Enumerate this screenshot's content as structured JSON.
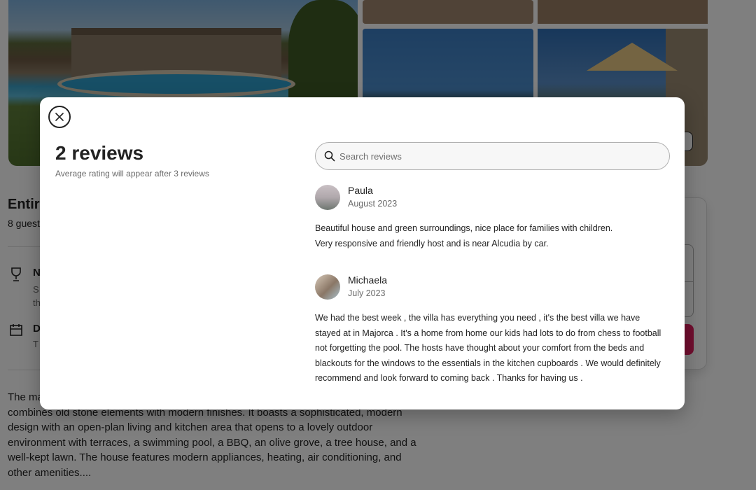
{
  "listing": {
    "title": "Entire",
    "subtitle": "8 guest",
    "features": [
      {
        "icon": "trophy-icon",
        "title": "N",
        "sub": "S\nth"
      },
      {
        "icon": "calendar-icon",
        "title": "D",
        "sub": "T"
      }
    ],
    "description": "The main house has been carefully restored after a significant refurbishment. The home combines old stone elements with modern finishes. It boasts a sophisticated, modern design with an open-plan living and kitchen area that opens to a lovely outdoor environment with terraces, a swimming pool, a BBQ, an olive grove, a tree house, and a well-kept lawn. The house features modern appliances, heating, air conditioning, and other amenities...."
  },
  "modal": {
    "reviews_count": "2 reviews",
    "rating_note": "Average rating will appear after 3 reviews",
    "search_placeholder": "Search reviews",
    "close_icon": "close-icon",
    "reviews": [
      {
        "name": "Paula",
        "date": "August 2023",
        "text": "Beautiful house and green surroundings, nice place for families with children.\nVery responsive and friendly host and is near Alcudia by car."
      },
      {
        "name": "Michaela",
        "date": "July 2023",
        "text": "We had the best week , the villa has everything you need , it's the best villa we have stayed at in Majorca . It's a home from home our kids had lots to do from chess to football not forgetting the pool. The hosts have thought about your comfort from the beds and blackouts for the windows to the essentials in the kitchen cupboards . We would definitely recommend and look forward to coming back . Thanks for having us ."
      }
    ]
  },
  "colors": {
    "reserve_accent": "#e31c5f",
    "overlay": "rgba(0,0,0,0.5)"
  }
}
